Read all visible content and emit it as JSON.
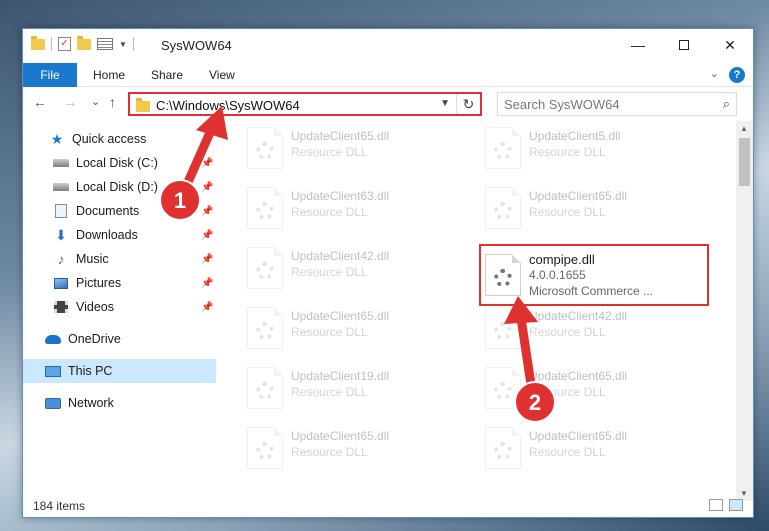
{
  "window": {
    "title": "SysWOW64",
    "minimize_glyph": "—",
    "close_glyph": "✕"
  },
  "ribbon": {
    "tabs": [
      "File",
      "Home",
      "Share",
      "View"
    ]
  },
  "navbar": {
    "back_glyph": "←",
    "forward_glyph": "→",
    "recent_glyph": "⌄",
    "up_glyph": "↑",
    "address": "C:\\Windows\\SysWOW64",
    "refresh_glyph": "↻",
    "search_placeholder": "Search SysWOW64"
  },
  "sidebar": {
    "items": [
      {
        "label": "Quick access",
        "icon": "star-icon",
        "pinned": false
      },
      {
        "label": "Local Disk (C:)",
        "icon": "disk-icon",
        "pinned": true
      },
      {
        "label": "Local Disk (D:)",
        "icon": "disk-icon",
        "pinned": true
      },
      {
        "label": "Documents",
        "icon": "document-icon",
        "pinned": true
      },
      {
        "label": "Downloads",
        "icon": "download-icon",
        "pinned": true
      },
      {
        "label": "Music",
        "icon": "music-icon",
        "pinned": true
      },
      {
        "label": "Pictures",
        "icon": "pictures-icon",
        "pinned": true
      },
      {
        "label": "Videos",
        "icon": "videos-icon",
        "pinned": true
      },
      {
        "label": "OneDrive",
        "icon": "cloud-icon",
        "pinned": false
      },
      {
        "label": "This PC",
        "icon": "computer-icon",
        "pinned": false,
        "selected": true
      },
      {
        "label": "Network",
        "icon": "network-icon",
        "pinned": false
      }
    ]
  },
  "files": {
    "left_column": [
      {
        "name": "UpdateClient65.dll",
        "type": "Resource DLL"
      },
      {
        "name": "UpdateClient63.dll",
        "type": "Resource DLL"
      },
      {
        "name": "UpdateClient42.dll",
        "type": "Resource DLL"
      },
      {
        "name": "UpdateClient65.dll",
        "type": "Resource DLL"
      },
      {
        "name": "UpdateClient19.dll",
        "type": "Resource DLL"
      },
      {
        "name": "UpdateClient65.dll",
        "type": "Resource DLL"
      }
    ],
    "right_column": [
      {
        "name": "UpdateClient5.dll",
        "type": "Resource DLL"
      },
      {
        "name": "UpdateClient65.dll",
        "type": "Resource DLL"
      },
      {
        "name": "UpdateClient42.dll",
        "type": "Resource DLL"
      },
      {
        "name": "UpdateClient65.dll",
        "type": "Resource DLL"
      },
      {
        "name": "UpdateClient65.dll",
        "type": "Resource DLL"
      }
    ],
    "highlighted": {
      "name": "compipe.dll",
      "version": "4.0.0.1655",
      "description": "Microsoft Commerce ..."
    }
  },
  "status": {
    "item_count": "184 items"
  },
  "annotations": {
    "step1": "1",
    "step2": "2",
    "color": "#e03131"
  }
}
